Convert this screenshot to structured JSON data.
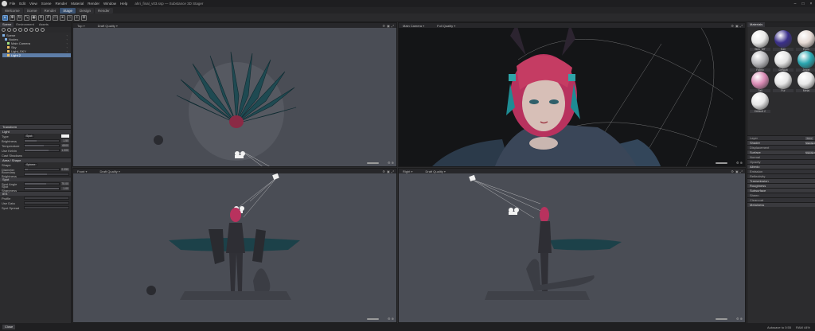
{
  "app": {
    "title": "ahri_final_v03.ssp — Substance 3D Stager",
    "menu": [
      "File",
      "Edit",
      "View",
      "Scene",
      "Render",
      "Material",
      "Render",
      "Window",
      "Help"
    ]
  },
  "tabs": [
    {
      "label": "Welcome",
      "active": false
    },
    {
      "label": "Scene",
      "active": false
    },
    {
      "label": "Render",
      "active": false
    },
    {
      "label": "Stage",
      "active": true
    },
    {
      "label": "Design",
      "active": false
    },
    {
      "label": "Render",
      "active": false
    }
  ],
  "toolbar": {
    "icons": [
      "select-icon",
      "move-icon",
      "rotate-icon",
      "scale-icon",
      "camera-icon",
      "light-icon",
      "grid-icon",
      "frame-icon",
      "snap-icon",
      "lasso-icon",
      "search-icon",
      "settings-icon"
    ]
  },
  "left_panel": {
    "tabs": [
      "Scene",
      "Environment",
      "Assets"
    ],
    "outline": [
      {
        "label": "Scene",
        "color": "#7fb1e6",
        "selected": false
      },
      {
        "label": "Nodes",
        "color": "#7fb1e6",
        "selected": false
      },
      {
        "label": "Main Camera",
        "color": "#9fe07f",
        "selected": false
      },
      {
        "label": "Sky",
        "color": "#f0c060",
        "selected": false
      },
      {
        "label": "Light_SKY",
        "color": "#f0c060",
        "selected": false
      },
      {
        "label": "Light 2",
        "color": "#f0c060",
        "selected": true
      }
    ],
    "sections": {
      "transform": "Transform",
      "light": "Light",
      "light_type": "Spot",
      "brightness_label": "Brightness",
      "brightness_value": "1.50",
      "temperature_label": "Temperature",
      "temperature_value": "6500",
      "intensity_label": "Use Kelvin",
      "intensity_value": "1.000",
      "cast_shadows": "Cast Shadows",
      "area_shape": "Area / Shape",
      "shape_label": "Shape",
      "shape_value": "Sphere",
      "diameter_label": "Diameter",
      "diameter_value": "0.050",
      "boundary_label": "Boundary Brightness",
      "spot_header": "Spot",
      "spot_angle_label": "Spot Angle",
      "spot_angle_value": "75.00",
      "spot_sharpness_label": "Spot Sharpness",
      "spot_sharpness_value": "1.00",
      "ies_header": "IES",
      "ies_profile": "Profile",
      "ies_intensity": "Use Data",
      "ies_spread": "Spot Spread"
    }
  },
  "viewports": [
    {
      "name": "Top",
      "camera": "Top",
      "quality": "Draft Quality"
    },
    {
      "name": "Main Camera",
      "camera": "Main Camera",
      "quality": "Full Quality"
    },
    {
      "name": "Front",
      "camera": "Front",
      "quality": "Draft Quality"
    },
    {
      "name": "Right",
      "camera": "Right",
      "quality": "Draft Quality"
    }
  ],
  "right_panel": {
    "header": "Materials",
    "materials": [
      {
        "name": "Skin_MT",
        "color": "#e8e8e8"
      },
      {
        "name": "Hair",
        "color": "#3a2f8a"
      },
      {
        "name": "Eyes",
        "color": "#e5d9d4"
      },
      {
        "name": "Fabric",
        "color": "#b8b8bc"
      },
      {
        "name": "Default",
        "color": "#e3e3e3"
      },
      {
        "name": "Jewel",
        "color": "#2aa6b0"
      },
      {
        "name": "Tail",
        "color": "#d98ab4"
      },
      {
        "name": "Fur",
        "color": "#e6e6e6"
      },
      {
        "name": "Metal",
        "color": "#e8e8e8"
      },
      {
        "name": "Default 2",
        "color": "#e6e6e6"
      }
    ],
    "sections": [
      {
        "label": "Layer",
        "tag": "Base",
        "dim": true
      },
      {
        "label": "Shader",
        "tag": "Standard",
        "dim": false
      },
      {
        "label": "Displacement",
        "tag": "",
        "dim": true
      },
      {
        "label": "Surface",
        "tag": "Standard",
        "dim": false
      },
      {
        "label": "Normal",
        "tag": "",
        "dim": true
      },
      {
        "label": "Opacity",
        "tag": "",
        "dim": true
      },
      {
        "label": "Albedo",
        "tag": "",
        "dim": false
      },
      {
        "label": "Emission",
        "tag": "",
        "dim": true
      },
      {
        "label": "Reflectivity",
        "tag": "",
        "dim": true
      },
      {
        "label": "Transmission",
        "tag": "",
        "dim": false
      },
      {
        "label": "Roughness",
        "tag": "",
        "dim": false
      },
      {
        "label": "Subsurface",
        "tag": "",
        "dim": false
      },
      {
        "label": "Sheen",
        "tag": "",
        "dim": true
      },
      {
        "label": "Clearcoat",
        "tag": "",
        "dim": true
      },
      {
        "label": "Metalness",
        "tag": "",
        "dim": false
      }
    ]
  },
  "status": {
    "button": "Close",
    "center": "Autosave to 0:55",
    "right": "RAM 44%"
  },
  "colors": {
    "viewport_bg": "#4a4d55",
    "render_bg": "#111213",
    "accent": "#3d6fa8",
    "selection": "#5e7ea8",
    "hair": "#c53c63",
    "teal": "#163b44"
  }
}
